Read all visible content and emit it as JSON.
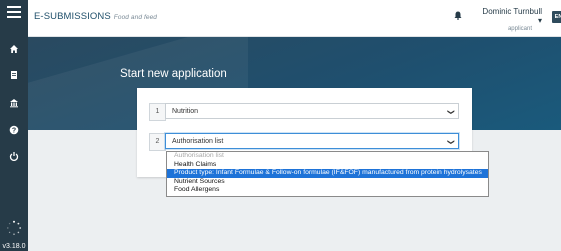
{
  "topbar": {
    "brand": "E-SUBMISSIONS",
    "brand_sub": "Food and feed",
    "user_name": "Dominic Turnbull ▾",
    "user_role": "applicant",
    "avatar": "EN"
  },
  "sidebar": {
    "icons": [
      "menu-icon",
      "home-icon",
      "document-icon",
      "building-icon",
      "help-icon",
      "power-icon",
      "spinner-icon"
    ],
    "version": "v3.18.0"
  },
  "banner": {
    "title": "Start new application"
  },
  "steps": [
    {
      "number": "1",
      "value": "Nutrition"
    },
    {
      "number": "2",
      "value": "Authorisation list"
    }
  ],
  "dropdown": {
    "options": [
      {
        "label": "Authorisation list",
        "state": "disabled"
      },
      {
        "label": "Health Claims",
        "state": "normal"
      },
      {
        "label": "Product type: Infant Formulae & Follow-on formulae (IF&FOF) manufactured from protein hydrolysates",
        "state": "highlighted"
      },
      {
        "label": "Nutrient Sources",
        "state": "normal"
      },
      {
        "label": "Food Allergens",
        "state": "normal"
      }
    ]
  },
  "colors": {
    "sidebar": "#263b48",
    "banner": "#1f4f6e",
    "highlight": "#1e73d8",
    "page_bg": "#eceff1"
  }
}
